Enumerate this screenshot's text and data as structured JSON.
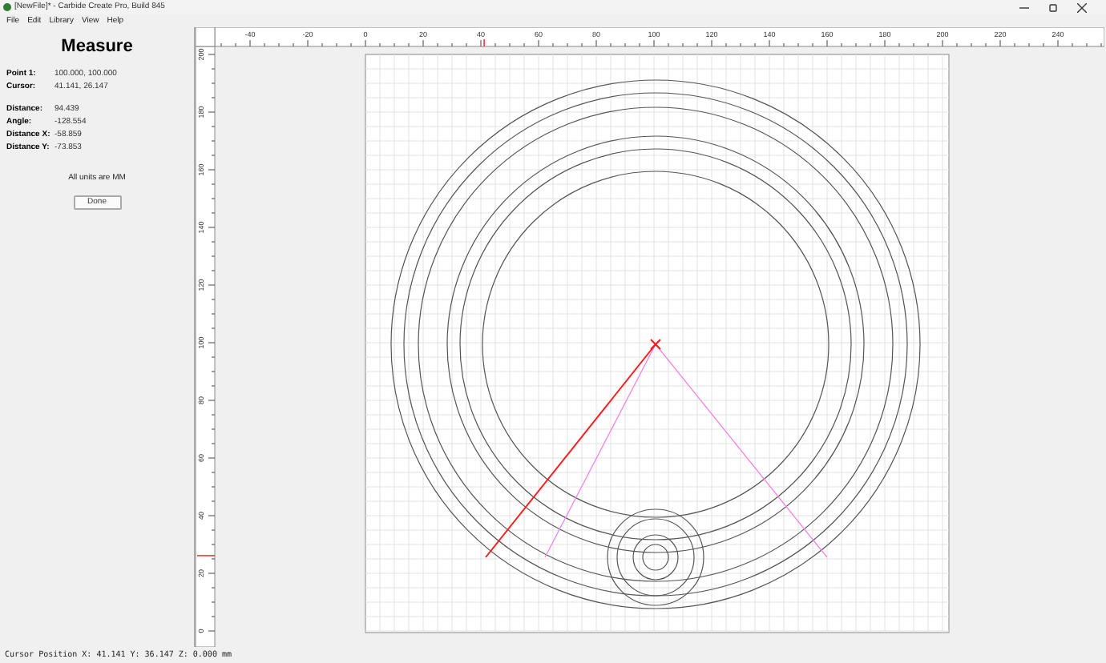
{
  "window": {
    "title": "[NewFile]* - Carbide Create Pro, Build 845"
  },
  "menu": [
    "File",
    "Edit",
    "Library",
    "View",
    "Help"
  ],
  "measure": {
    "title": "Measure",
    "points": [
      {
        "label": "Point 1:",
        "value": "100.000, 100.000"
      },
      {
        "label": "Cursor:",
        "value": "41.141, 26.147"
      }
    ],
    "results": [
      {
        "label": "Distance:",
        "value": "94.439"
      },
      {
        "label": "Angle:",
        "value": "-128.554"
      },
      {
        "label": "Distance X:",
        "value": "-58.859"
      },
      {
        "label": "Distance Y:",
        "value": "-73.853"
      }
    ],
    "note": "All units are MM",
    "done_button": "Done"
  },
  "rulers": {
    "top_labels": [
      "-40",
      "-20",
      "0",
      "20",
      "40",
      "60",
      "80",
      "100",
      "120",
      "140",
      "160",
      "180",
      "200",
      "220",
      "240"
    ],
    "left_labels": [
      "200",
      "180",
      "160",
      "140",
      "120",
      "100",
      "80",
      "60",
      "40",
      "20",
      "0"
    ]
  },
  "status_bar": "Cursor Position X: 41.141 Y: 36.147 Z: 0.000 mm"
}
